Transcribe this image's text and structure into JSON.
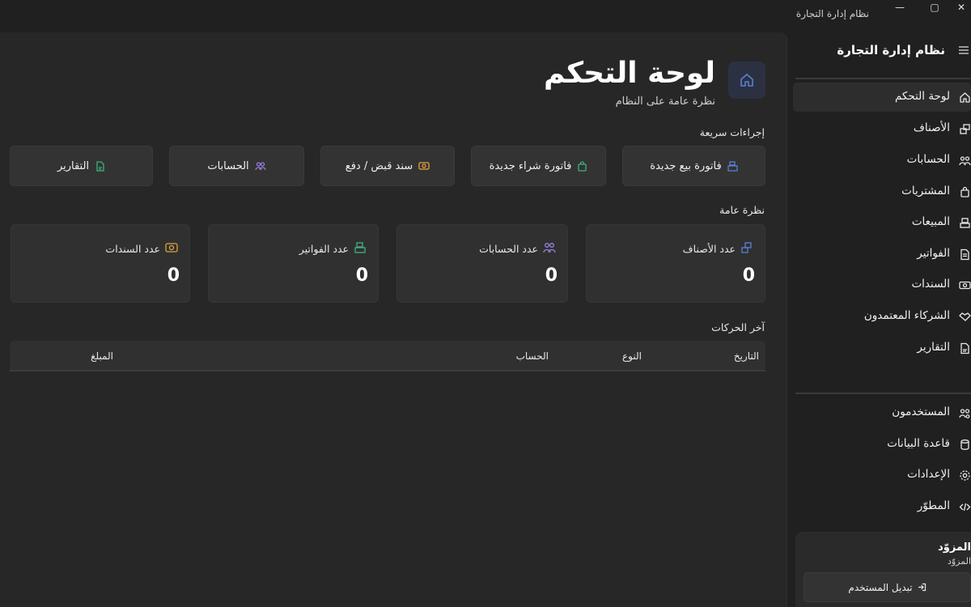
{
  "window": {
    "title": "نظام إدارة التجارة",
    "minimize": "—",
    "maximize": "▢",
    "close": "✕"
  },
  "header": {
    "title": "لوحة التحكم",
    "subtitle": "نظرة عامة على النظام",
    "icon": "home-icon",
    "accent": "#5b7fd6"
  },
  "quick_actions": {
    "label": "إجراءات سريعة",
    "items": [
      {
        "label": "فاتورة بيع جديدة",
        "icon": "register-icon",
        "color": "#5b7fd6"
      },
      {
        "label": "فاتورة شراء جديدة",
        "icon": "shopping-bag-icon",
        "color": "#3fb27f"
      },
      {
        "label": "سند قبض / دفع",
        "icon": "cash-icon",
        "color": "#e0a33a"
      },
      {
        "label": "الحسابات",
        "icon": "users-icon",
        "color": "#9b7fe0"
      },
      {
        "label": "التقارير",
        "icon": "report-icon",
        "color": "#3fb27f"
      }
    ]
  },
  "overview": {
    "label": "نظرة عامة",
    "stats": [
      {
        "label": "عدد الأصناف",
        "value": "0",
        "icon": "cubes-icon",
        "color": "#5b7fd6"
      },
      {
        "label": "عدد الحسابات",
        "value": "0",
        "icon": "users-icon",
        "color": "#9b7fe0"
      },
      {
        "label": "عدد الفواتير",
        "value": "0",
        "icon": "register-icon",
        "color": "#3fb27f"
      },
      {
        "label": "عدد السندات",
        "value": "0",
        "icon": "cash-icon",
        "color": "#e0a33a"
      }
    ]
  },
  "recent": {
    "label": "آخر الحركات",
    "columns": [
      "التاريخ",
      "النوع",
      "الحساب",
      "المبلغ"
    ]
  },
  "sidebar": {
    "app_name": "نظام إدارة التجارة",
    "items": [
      {
        "label": "لوحة التحكم",
        "icon": "home-icon",
        "active": true
      },
      {
        "label": "الأصناف",
        "icon": "cubes-icon"
      },
      {
        "label": "الحسابات",
        "icon": "users-icon"
      },
      {
        "label": "المشتريات",
        "icon": "shopping-bag-icon"
      },
      {
        "label": "المبيعات",
        "icon": "register-icon"
      },
      {
        "label": "الفواتير",
        "icon": "document-icon"
      },
      {
        "label": "السندات",
        "icon": "cash-icon"
      },
      {
        "label": "الشركاء المعتمدون",
        "icon": "handshake-icon"
      },
      {
        "label": "التقارير",
        "icon": "report-icon"
      }
    ],
    "bottom_items": [
      {
        "label": "المستخدمون",
        "icon": "users-gear-icon"
      },
      {
        "label": "قاعدة البيانات",
        "icon": "database-icon"
      },
      {
        "label": "الإعدادات",
        "icon": "gear-icon"
      },
      {
        "label": "المطوّر",
        "icon": "code-icon"
      }
    ],
    "user": {
      "name": "المزوّد",
      "role": "المزوّد",
      "switch_label": "تبديل المستخدم"
    }
  }
}
